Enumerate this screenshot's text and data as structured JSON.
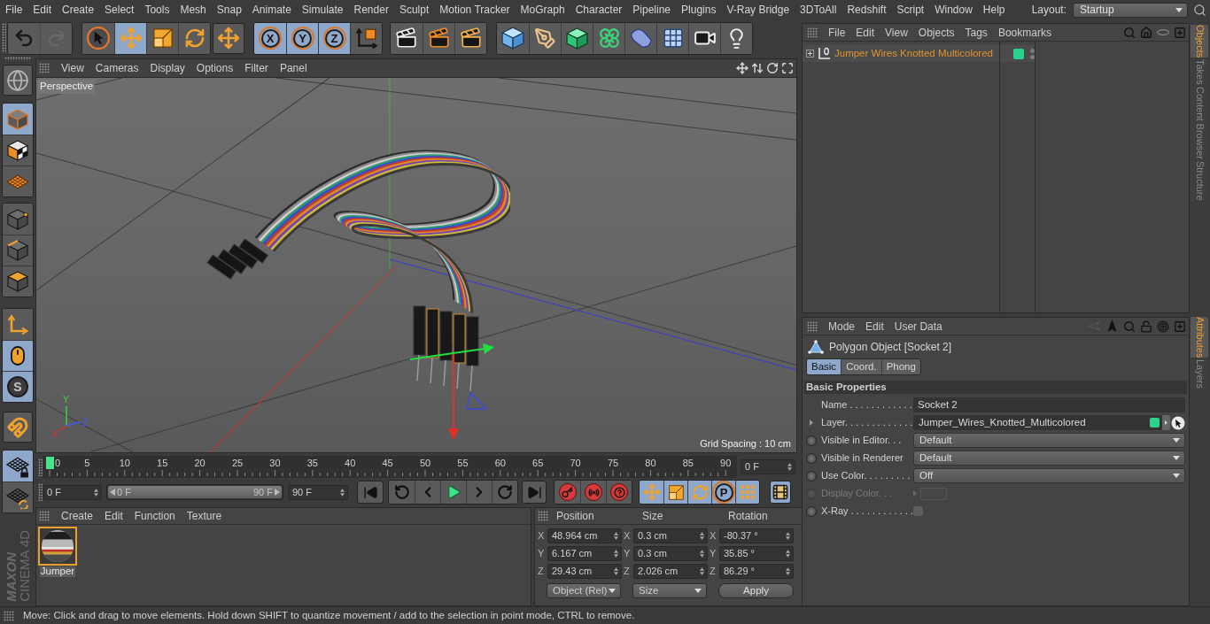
{
  "menu_bar": {
    "items": [
      "File",
      "Edit",
      "Create",
      "Select",
      "Tools",
      "Mesh",
      "Snap",
      "Animate",
      "Simulate",
      "Render",
      "Sculpt",
      "Motion Tracker",
      "MoGraph",
      "Character",
      "Pipeline",
      "Plugins",
      "V-Ray Bridge",
      "3DToAll",
      "Redshift",
      "Script",
      "Window",
      "Help"
    ],
    "layout_label": "Layout:",
    "layout_value": "Startup"
  },
  "toolbar": {
    "groups": [
      {
        "items": [
          {
            "kind": "undo",
            "selected": false,
            "disabled": false
          },
          {
            "kind": "redo",
            "selected": false,
            "disabled": true
          }
        ]
      },
      {
        "items": [
          {
            "kind": "live-select",
            "selected": false,
            "disabled": false
          },
          {
            "kind": "move",
            "selected": true,
            "disabled": false
          },
          {
            "kind": "scale",
            "selected": false,
            "disabled": false
          },
          {
            "kind": "rotate",
            "selected": false,
            "disabled": false
          }
        ]
      },
      {
        "items": [
          {
            "kind": "axis-move",
            "selected": false,
            "disabled": false
          }
        ]
      },
      {
        "items": [
          {
            "kind": "lock-axis",
            "label": "X",
            "selected": true,
            "disabled": false
          },
          {
            "kind": "lock-axis",
            "label": "Y",
            "selected": true,
            "disabled": false
          },
          {
            "kind": "lock-axis",
            "label": "Z",
            "selected": true,
            "disabled": false
          },
          {
            "kind": "coordinate-system",
            "selected": false,
            "disabled": false
          }
        ]
      },
      {
        "items": [
          {
            "kind": "render-view",
            "selected": false,
            "disabled": false
          },
          {
            "kind": "render-picture",
            "selected": false,
            "disabled": false
          },
          {
            "kind": "render-settings",
            "selected": false,
            "disabled": false
          }
        ]
      },
      {
        "items": [
          {
            "kind": "cube",
            "selected": false,
            "disabled": false
          },
          {
            "kind": "pen",
            "selected": false,
            "disabled": false
          },
          {
            "kind": "subdivision",
            "selected": false,
            "disabled": false
          },
          {
            "kind": "cloner",
            "selected": false,
            "disabled": false
          },
          {
            "kind": "deformer",
            "selected": false,
            "disabled": false
          },
          {
            "kind": "floor",
            "selected": false,
            "disabled": false
          },
          {
            "kind": "camera",
            "selected": false,
            "disabled": false
          },
          {
            "kind": "light",
            "selected": false,
            "disabled": false
          }
        ]
      }
    ]
  },
  "mode_bar": {
    "groups": [
      {
        "items": [
          {
            "kind": "world",
            "selected": false
          }
        ]
      },
      {
        "items": [
          {
            "kind": "model",
            "selected": true
          },
          {
            "kind": "texture",
            "selected": false
          },
          {
            "kind": "workplane",
            "selected": false
          }
        ]
      },
      {
        "items": [
          {
            "kind": "points",
            "selected": false
          },
          {
            "kind": "edges",
            "selected": false
          },
          {
            "kind": "polygons",
            "selected": false
          }
        ]
      },
      {
        "items": [
          {
            "kind": "axis",
            "selected": false
          },
          {
            "kind": "tweak",
            "selected": true
          },
          {
            "kind": "solo",
            "label": "S",
            "selected": true
          }
        ]
      },
      {
        "items": [
          {
            "kind": "snap",
            "selected": false
          }
        ]
      },
      {
        "items": [
          {
            "kind": "grid-lock",
            "selected": true
          },
          {
            "kind": "grid-sync",
            "selected": false
          }
        ]
      }
    ]
  },
  "logo": {
    "brand": "MAXON",
    "product": "CINEMA 4D"
  },
  "viewport": {
    "menu": [
      "View",
      "Cameras",
      "Display",
      "Options",
      "Filter",
      "Panel"
    ],
    "camera": "Perspective",
    "grid_spacing": "Grid Spacing : 10 cm",
    "axis_gizmo": {
      "y": "Y",
      "z": "Z",
      "x": "X"
    }
  },
  "timeline": {
    "ticks": [
      "0",
      "5",
      "10",
      "15",
      "20",
      "25",
      "30",
      "35",
      "40",
      "45",
      "50",
      "55",
      "60",
      "65",
      "70",
      "75",
      "80",
      "85",
      "90"
    ],
    "playhead": {
      "level": 0
    },
    "current_frame": "0 F"
  },
  "transport": {
    "start_frame": "0 F",
    "range": {
      "start": "0 F",
      "end": "90 F",
      "level": 1
    },
    "end_frame": "90 F",
    "groups": [
      {
        "items": [
          {
            "kind": "go-start",
            "selected": false
          }
        ]
      },
      {
        "items": [
          {
            "kind": "prev-key",
            "selected": false
          },
          {
            "kind": "prev-frame",
            "selected": false
          },
          {
            "kind": "play",
            "selected": false
          },
          {
            "kind": "next-frame",
            "selected": false
          },
          {
            "kind": "next-key",
            "selected": false
          }
        ]
      },
      {
        "items": [
          {
            "kind": "go-end",
            "selected": false
          }
        ]
      },
      {
        "items": [
          {
            "kind": "record",
            "selected": false
          },
          {
            "kind": "autokey",
            "selected": false
          },
          {
            "kind": "keyframe-selection",
            "selected": false
          }
        ]
      },
      {
        "items": [
          {
            "kind": "key-position",
            "selected": true
          },
          {
            "kind": "key-scale",
            "selected": true
          },
          {
            "kind": "key-rotation",
            "selected": true
          },
          {
            "kind": "key-parameter",
            "label": "P",
            "selected": true
          },
          {
            "kind": "key-points",
            "selected": true
          }
        ]
      },
      {
        "items": [
          {
            "kind": "timeline-window",
            "selected": true
          }
        ]
      }
    ]
  },
  "materials": {
    "menu": [
      "Create",
      "Edit",
      "Function",
      "Texture"
    ],
    "items": [
      {
        "name": "Jumper",
        "selected": true
      }
    ]
  },
  "coordinates": {
    "headers": [
      "Position",
      "Size",
      "Rotation"
    ],
    "rows": [
      {
        "cells": [
          {
            "axis": "X",
            "value": "48.964 cm"
          },
          {
            "axis": "X",
            "value": "0.3 cm"
          },
          {
            "axis": "X",
            "value": "-80.37 °"
          }
        ]
      },
      {
        "cells": [
          {
            "axis": "Y",
            "value": "6.167 cm"
          },
          {
            "axis": "Y",
            "value": "0.3 cm"
          },
          {
            "axis": "Y",
            "value": "35.85 °"
          }
        ]
      },
      {
        "cells": [
          {
            "axis": "Z",
            "value": "29.43 cm"
          },
          {
            "axis": "Z",
            "value": "2.026 cm"
          },
          {
            "axis": "Z",
            "value": "86.29 °"
          }
        ]
      }
    ],
    "mode": "Object (Rel)",
    "size_mode": "Size",
    "apply": "Apply"
  },
  "objects": {
    "menu": [
      "File",
      "Edit",
      "View",
      "Objects",
      "Tags",
      "Bookmarks"
    ],
    "items": [
      {
        "name": "Jumper Wires Knotted Multicolored",
        "selected": true,
        "expanded": false,
        "color": "#2bd18f"
      }
    ]
  },
  "attributes": {
    "menu": [
      "Mode",
      "Edit",
      "User Data"
    ],
    "title": "Polygon Object [Socket 2]",
    "tabs": [
      {
        "label": "Basic",
        "selected": true
      },
      {
        "label": "Coord.",
        "selected": false
      },
      {
        "label": "Phong",
        "selected": false
      }
    ],
    "section": "Basic Properties",
    "fields": [
      {
        "kind": "text",
        "label": "Name . . . . . . . . . . . .",
        "value": "Socket 2",
        "disabled": false
      },
      {
        "kind": "link",
        "label": "Layer. . . . . . . . . . . . .",
        "value": "Jumper_Wires_Knotted_Multicolored",
        "color": "#2bd18f",
        "disabled": false
      },
      {
        "kind": "dropdown",
        "label": "Visible in Editor. . .",
        "value": "Default",
        "disabled": false
      },
      {
        "kind": "dropdown",
        "label": "Visible in Renderer",
        "value": "Default",
        "disabled": false
      },
      {
        "kind": "dropdown",
        "label": "Use Color. . . . . . . . .",
        "value": "Off",
        "disabled": false
      },
      {
        "kind": "color",
        "label": "Display Color. . .",
        "disabled": true
      },
      {
        "kind": "checkbox",
        "label": "X-Ray . . . . . . . . . . . .",
        "checked": false,
        "disabled": false
      }
    ]
  },
  "side_tabs": {
    "top": [
      {
        "label": "Objects",
        "selected": true
      },
      {
        "label": "Takes",
        "selected": false
      },
      {
        "label": "Content Browser",
        "selected": false
      },
      {
        "label": "Structure",
        "selected": false
      }
    ],
    "bottom": [
      {
        "label": "Attributes",
        "selected": true
      },
      {
        "label": "Layers",
        "selected": false
      }
    ]
  },
  "status_bar": "Move: Click and drag to move elements. Hold down SHIFT to quantize movement / add to the selection in point mode, CTRL to remove."
}
